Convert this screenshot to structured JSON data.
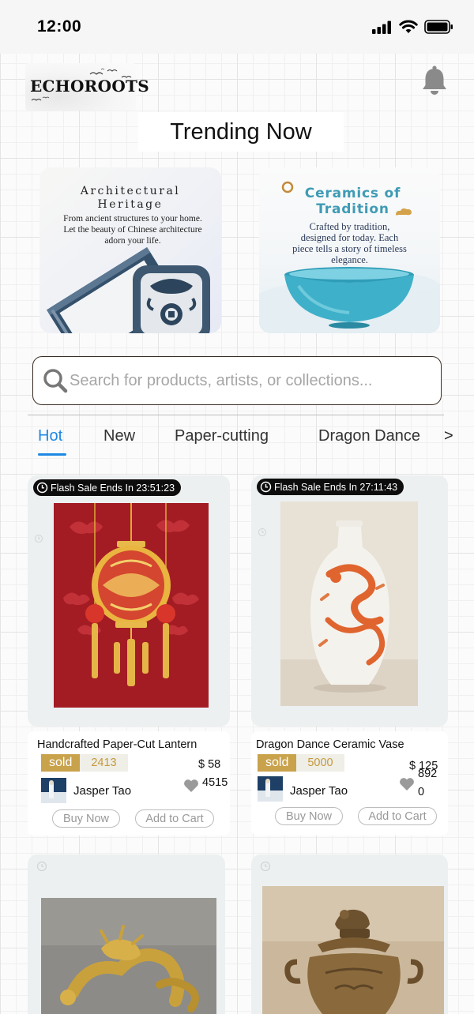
{
  "status_bar": {
    "time": "12:00"
  },
  "header": {
    "logo_text": "ECHOROOTS",
    "section_title": "Trending Now"
  },
  "banners": {
    "architecture": {
      "title_line1": "Architectural",
      "title_line2": "Heritage",
      "desc_line1": "From ancient structures to your home.",
      "desc_line2": "Let the beauty of Chinese architecture",
      "desc_line3": "adorn your life."
    },
    "ceramics": {
      "title_line1": "Ceramics of",
      "title_line2": "Tradition",
      "desc_line1": "Crafted by tradition,",
      "desc_line2": "designed for today. Each",
      "desc_line3": "piece tells a story of timeless",
      "desc_line4": "elegance."
    }
  },
  "search": {
    "placeholder": "Search for products, artists, or collections...",
    "value": ""
  },
  "tabs": {
    "items": [
      {
        "label": "Hot",
        "active": true
      },
      {
        "label": "New",
        "active": false
      },
      {
        "label": "Paper-cutting",
        "active": false
      },
      {
        "label": "Dragon Dance",
        "active": false
      }
    ],
    "more": ">"
  },
  "products": [
    {
      "flash_label": "Flash Sale Ends In 23:51:23",
      "title": "Handcrafted Paper-Cut Lantern",
      "sold_label": "sold",
      "sold_count": "2413",
      "price": "$ 58",
      "likes": "4515",
      "artist": "Jasper Tao",
      "buy_label": "Buy Now",
      "cart_label": "Add to Cart"
    },
    {
      "flash_label": "Flash Sale Ends In 27:11:43",
      "title": "Dragon Dance Ceramic Vase",
      "sold_label": "sold",
      "sold_count": "5000",
      "price": "$ 125",
      "likes_line1": "892",
      "likes_line2": "0",
      "artist": "Jasper Tao",
      "buy_label": "Buy Now",
      "cart_label": "Add to Cart"
    }
  ],
  "colors": {
    "accent": "#1e88e5",
    "sold_gold": "#c9a24c",
    "ceramic_title": "#3f9bb5",
    "lantern_red": "#a31c24"
  }
}
